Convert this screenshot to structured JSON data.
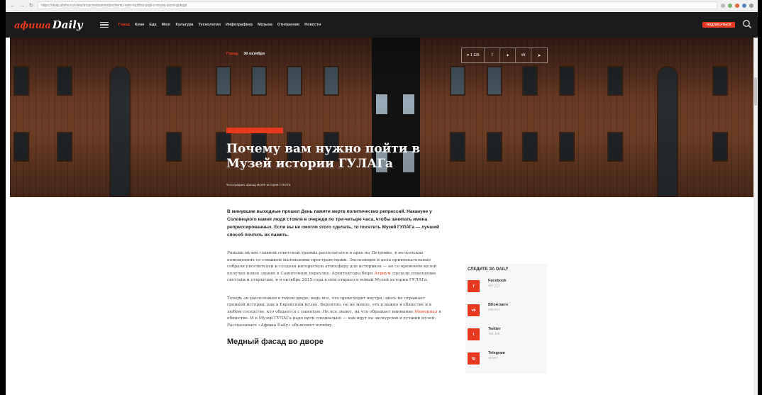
{
  "browser": {
    "back_icon": "back-arrow-icon",
    "forward_icon": "forward-arrow-icon",
    "reload_icon": "reload-icon",
    "url": "https://daily.afisha.ru/cities/moscow/events/pochemu-vam-nuzhno-pojti-v-muzej-istorii-gulaga"
  },
  "header": {
    "logo_brand": "афиша",
    "logo_daily": "Daily",
    "nav": [
      "Город",
      "Кино",
      "Еда",
      "Мозг",
      "Культура",
      "Технологии",
      "Инфографика",
      "Музыка",
      "Отношения",
      "Новости"
    ],
    "active_nav_index": 0,
    "subscribe_label": "ПОДПИСАТЬСЯ",
    "accent_color": "#e8381f"
  },
  "hero": {
    "crumb_section": "Город",
    "crumb_date": "30 октября",
    "share_count": "1 126",
    "share_icons": [
      "facebook-icon",
      "twitter-icon",
      "vk-icon",
      "telegram-icon"
    ],
    "title": "Почему вам нужно пойти в Музей истории ГУЛАГа",
    "caption": "Фотография: фасад музея истории ГУЛАГа"
  },
  "article": {
    "lead": "В минувшие выходные прошел День памяти жертв политических репрессий. Накануне у Соловецкого камня люди стояли в очереди по три-четыре часа, чтобы зачитать имена репрессированных. Если вы не смогли этого сделать, то посетить Музей ГУЛАГа — лучший способ почтить их память.",
    "p1_before": "Раньше музей главной советской травмы располагался в арке на Петровке, в нескольких помещениях со слишком маленькими пространствами. Экспозиция и дела привлекательные собрали посетителей и создали интересную атмосферу для историков — но со временем музей получил новое здание в Самотечном переулке. Архитекторы бюро ",
    "p1_link": "Атриум",
    "p1_after": " сделали помещение светлым и открытым, и в октябре 2015 года в нем открылся новый Музей истории ГУЛАГа.",
    "p2_before": "Теперь он расположен в тихом дворе, ведь все, что происходит внутри, здесь не отражает громкой истории, как в Еврейском музее. Вероятно, но не менее, это и важно в обществе и в любом соседстве, кто общается с памятью. Не все знают, на что обращает внимание ",
    "p2_link": "Мемориал",
    "p2_after": " в обществе. И в Музей ГУЛАГа надо идти специально — как идут на экскурсию в лучший музей. Рассказывает «Афиша Daily» объясняет почему.",
    "subheading": "Медный фасад во дворе"
  },
  "sidebar": {
    "title": "СЛЕДИТЕ ЗА DAILY",
    "socials": [
      {
        "badge": "f",
        "icon": "facebook-icon",
        "name": "Facebook",
        "count": "467 213"
      },
      {
        "badge": "vk",
        "icon": "vk-icon",
        "name": "ВКонтакте",
        "count": "265 874"
      },
      {
        "badge": "t",
        "icon": "twitter-icon",
        "name": "Twitter",
        "count": "763 488"
      },
      {
        "badge": "tg",
        "icon": "telegram-icon",
        "name": "Telegram",
        "count": "10 867"
      }
    ]
  }
}
